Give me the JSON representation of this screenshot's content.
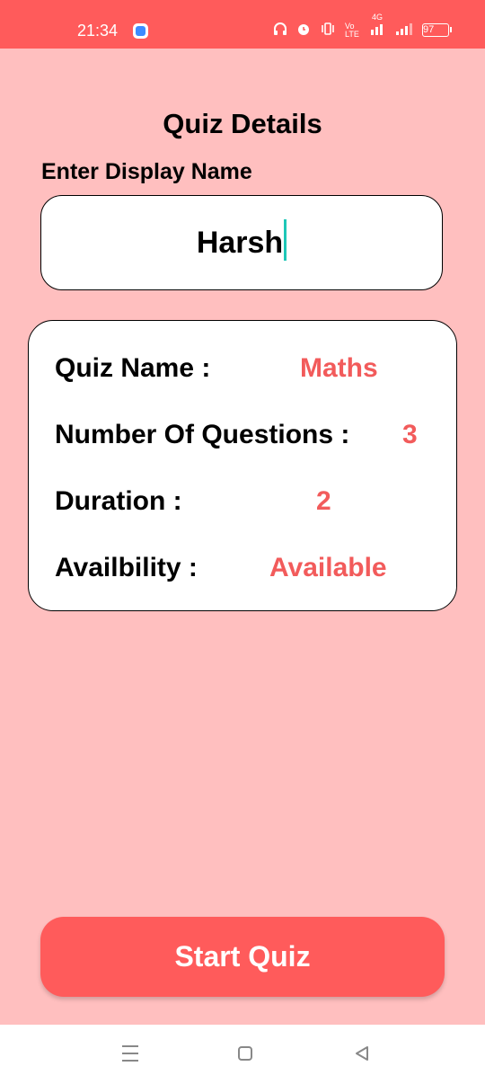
{
  "status_bar": {
    "time": "21:34",
    "network_label": "4G",
    "volte_label": "Vo LTE",
    "battery": "97"
  },
  "page": {
    "title": "Quiz Details",
    "display_name_label": "Enter Display Name",
    "display_name_value": "Harsh"
  },
  "quiz": {
    "name_label": "Quiz Name :",
    "name_value": "Maths",
    "questions_label": "Number Of Questions :",
    "questions_value": "3",
    "duration_label": "Duration :",
    "duration_value": "2",
    "availability_label": "Availbility :",
    "availability_value": "Available"
  },
  "actions": {
    "start_label": "Start Quiz"
  },
  "colors": {
    "accent": "#ff5b5b",
    "background": "#ffbfbf",
    "value_text": "#f25b5b",
    "caret": "#1ec7b7"
  }
}
